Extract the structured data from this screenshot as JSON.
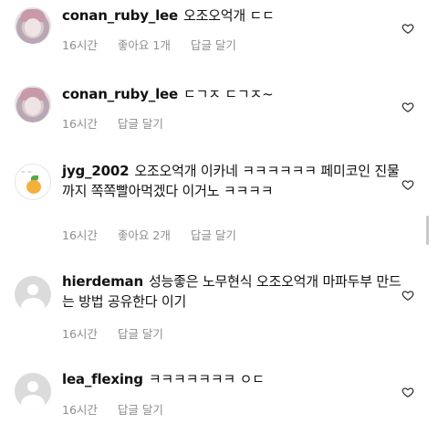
{
  "comments": [
    {
      "username": "conan_ruby_lee",
      "text": "오조오억개 ㄷㄷ",
      "time": "16시간",
      "likes": "좋아요 1개",
      "reply": "답글 달기"
    },
    {
      "username": "conan_ruby_lee",
      "text": "ㄷㄱㅈ ㄷㄱㅈ~",
      "time": "16시간",
      "likes": "",
      "reply": "답글 달기"
    },
    {
      "username": "jyg_2002",
      "text": "오조오억개 이카네 ㅋㅋㅋㅋㅋㅋ  페미코인 진물까지 쪽쪽빨아먹겠다 이거노 ㅋㅋㅋㅋ",
      "time": "16시간",
      "likes": "좋아요 2개",
      "reply": "답글 달기"
    },
    {
      "username": "hierdeman",
      "text": "성능좋은 노무현식 오조오억개 마파두부 만드는 방법 공유한다 이기",
      "time": "16시간",
      "likes": "",
      "reply": "답글 달기"
    },
    {
      "username": "lea_flexing",
      "text": "ㅋㅋㅋㅋㅋㅋㅋ ㅇㄷ",
      "time": "16시간",
      "likes": "",
      "reply": "답글 달기"
    }
  ],
  "icons": {
    "like": "heart-outline-icon",
    "avatar_default": "default-avatar-icon"
  }
}
